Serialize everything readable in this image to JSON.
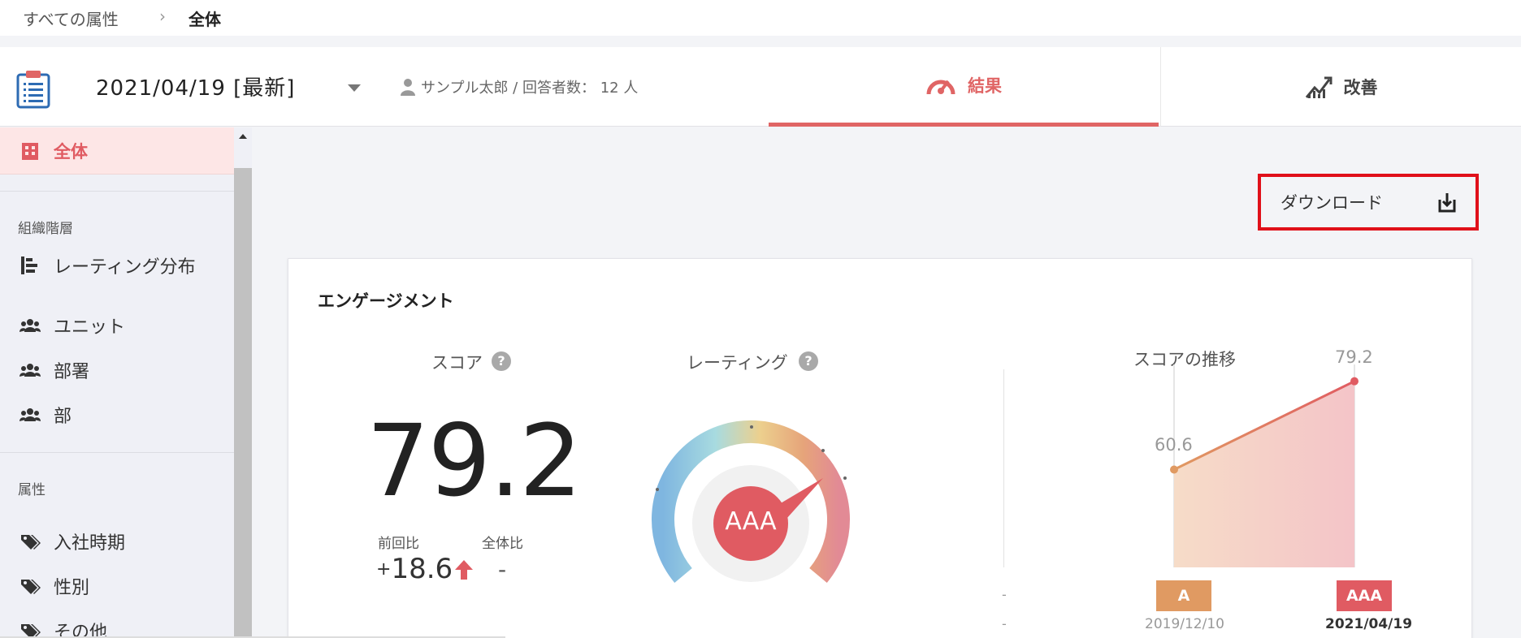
{
  "breadcrumb": {
    "parent": "すべての属性",
    "separator": "›",
    "current": "全体"
  },
  "header": {
    "date": "2021/04/19 [最新]",
    "user_info": "サンプル太郎 / 回答者数： 12 人",
    "tabs": [
      {
        "label": "結果",
        "active": true,
        "color": "#e06565"
      },
      {
        "label": "改善",
        "active": false
      }
    ]
  },
  "sidebar": {
    "active_item": "全体",
    "sections": [
      {
        "heading": "組織階層",
        "items": [
          "レーティング分布",
          "ユニット",
          "部署",
          "部"
        ]
      },
      {
        "heading": "属性",
        "items": [
          "入社時期",
          "性別",
          "その他"
        ]
      }
    ]
  },
  "download": {
    "label": "ダウンロード"
  },
  "card": {
    "title": "エンゲージメント",
    "score": {
      "label": "スコア",
      "value": "79.2",
      "prev_label": "前回比",
      "prev_sign": "+",
      "prev_value": "18.6",
      "overall_label": "全体比",
      "overall_value": "-"
    },
    "rating": {
      "label": "レーティング",
      "value": "AAA"
    },
    "trend": {
      "label": "スコアの推移",
      "points": [
        {
          "date": "2019/12/10",
          "score": 60.6,
          "score_label": "60.6",
          "rating": "A",
          "color": "#e09a62"
        },
        {
          "date": "2021/04/19",
          "score": 79.2,
          "score_label": "79.2",
          "rating": "AAA",
          "color": "#e05b62"
        }
      ],
      "dashes": [
        "-",
        "-"
      ]
    }
  },
  "help_glyph": "?"
}
